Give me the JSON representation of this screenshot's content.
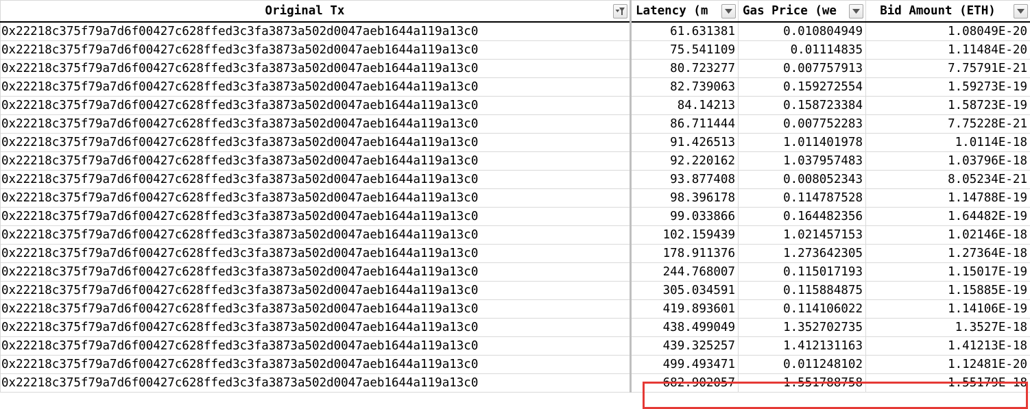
{
  "headers": [
    {
      "label": "Original Tx",
      "filter": "active"
    },
    {
      "label": "Latency (m",
      "filter": "dropdown"
    },
    {
      "label": "Gas Price (we",
      "filter": "dropdown"
    },
    {
      "label": "Bid Amount (ETH)",
      "filter": "dropdown"
    }
  ],
  "rows": [
    {
      "tx": "0x22218c375f79a7d6f00427c628ffed3c3fa3873a502d0047aeb1644a119a13c0",
      "latency": "61.631381",
      "gas": "0.010804949",
      "bid": "1.08049E-20"
    },
    {
      "tx": "0x22218c375f79a7d6f00427c628ffed3c3fa3873a502d0047aeb1644a119a13c0",
      "latency": "75.541109",
      "gas": "0.01114835",
      "bid": "1.11484E-20"
    },
    {
      "tx": "0x22218c375f79a7d6f00427c628ffed3c3fa3873a502d0047aeb1644a119a13c0",
      "latency": "80.723277",
      "gas": "0.007757913",
      "bid": "7.75791E-21"
    },
    {
      "tx": "0x22218c375f79a7d6f00427c628ffed3c3fa3873a502d0047aeb1644a119a13c0",
      "latency": "82.739063",
      "gas": "0.159272554",
      "bid": "1.59273E-19"
    },
    {
      "tx": "0x22218c375f79a7d6f00427c628ffed3c3fa3873a502d0047aeb1644a119a13c0",
      "latency": "84.14213",
      "gas": "0.158723384",
      "bid": "1.58723E-19"
    },
    {
      "tx": "0x22218c375f79a7d6f00427c628ffed3c3fa3873a502d0047aeb1644a119a13c0",
      "latency": "86.711444",
      "gas": "0.007752283",
      "bid": "7.75228E-21"
    },
    {
      "tx": "0x22218c375f79a7d6f00427c628ffed3c3fa3873a502d0047aeb1644a119a13c0",
      "latency": "91.426513",
      "gas": "1.011401978",
      "bid": "1.0114E-18"
    },
    {
      "tx": "0x22218c375f79a7d6f00427c628ffed3c3fa3873a502d0047aeb1644a119a13c0",
      "latency": "92.220162",
      "gas": "1.037957483",
      "bid": "1.03796E-18"
    },
    {
      "tx": "0x22218c375f79a7d6f00427c628ffed3c3fa3873a502d0047aeb1644a119a13c0",
      "latency": "93.877408",
      "gas": "0.008052343",
      "bid": "8.05234E-21"
    },
    {
      "tx": "0x22218c375f79a7d6f00427c628ffed3c3fa3873a502d0047aeb1644a119a13c0",
      "latency": "98.396178",
      "gas": "0.114787528",
      "bid": "1.14788E-19"
    },
    {
      "tx": "0x22218c375f79a7d6f00427c628ffed3c3fa3873a502d0047aeb1644a119a13c0",
      "latency": "99.033866",
      "gas": "0.164482356",
      "bid": "1.64482E-19"
    },
    {
      "tx": "0x22218c375f79a7d6f00427c628ffed3c3fa3873a502d0047aeb1644a119a13c0",
      "latency": "102.159439",
      "gas": "1.021457153",
      "bid": "1.02146E-18"
    },
    {
      "tx": "0x22218c375f79a7d6f00427c628ffed3c3fa3873a502d0047aeb1644a119a13c0",
      "latency": "178.911376",
      "gas": "1.273642305",
      "bid": "1.27364E-18"
    },
    {
      "tx": "0x22218c375f79a7d6f00427c628ffed3c3fa3873a502d0047aeb1644a119a13c0",
      "latency": "244.768007",
      "gas": "0.115017193",
      "bid": "1.15017E-19"
    },
    {
      "tx": "0x22218c375f79a7d6f00427c628ffed3c3fa3873a502d0047aeb1644a119a13c0",
      "latency": "305.034591",
      "gas": "0.115884875",
      "bid": "1.15885E-19"
    },
    {
      "tx": "0x22218c375f79a7d6f00427c628ffed3c3fa3873a502d0047aeb1644a119a13c0",
      "latency": "419.893601",
      "gas": "0.114106022",
      "bid": "1.14106E-19"
    },
    {
      "tx": "0x22218c375f79a7d6f00427c628ffed3c3fa3873a502d0047aeb1644a119a13c0",
      "latency": "438.499049",
      "gas": "1.352702735",
      "bid": "1.3527E-18"
    },
    {
      "tx": "0x22218c375f79a7d6f00427c628ffed3c3fa3873a502d0047aeb1644a119a13c0",
      "latency": "439.325257",
      "gas": "1.412131163",
      "bid": "1.41213E-18"
    },
    {
      "tx": "0x22218c375f79a7d6f00427c628ffed3c3fa3873a502d0047aeb1644a119a13c0",
      "latency": "499.493471",
      "gas": "0.011248102",
      "bid": "1.12481E-20"
    },
    {
      "tx": "0x22218c375f79a7d6f00427c628ffed3c3fa3873a502d0047aeb1644a119a13c0",
      "latency": "682.902057",
      "gas": "1.551788758",
      "bid": "1.55179E-18"
    }
  ],
  "colors": {
    "gridline": "#d9d9d9",
    "highlight": "#e53935",
    "header_rule": "#000000"
  },
  "icons": {
    "active_filter": "filter-active-icon",
    "dropdown": "dropdown-arrow-icon"
  }
}
